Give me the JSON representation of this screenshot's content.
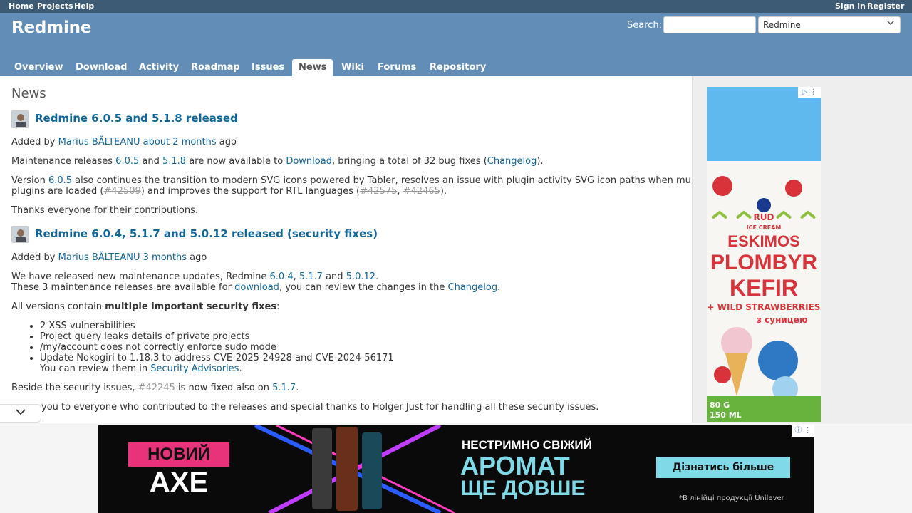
{
  "top_menu": {
    "home": "Home",
    "projects": "Projects",
    "help": "Help",
    "sign_in": "Sign in",
    "register": "Register"
  },
  "header": {
    "title": "Redmine",
    "search_label": "Search:",
    "search_value": "",
    "project_select": "Redmine"
  },
  "tabs": [
    "Overview",
    "Download",
    "Activity",
    "Roadmap",
    "Issues",
    "News",
    "Wiki",
    "Forums",
    "Repository"
  ],
  "selected_tab": "News",
  "page_title": "News",
  "news": [
    {
      "title": "Redmine 6.0.5 and 5.1.8 released",
      "added_by": "Added by",
      "author": "Marius BĂLTEANU",
      "ago_link": "about 2 months",
      "ago_suffix": "ago",
      "p1": {
        "t1": "Maintenance releases ",
        "l1": "6.0.5",
        "t2": " and ",
        "l2": "5.1.8",
        "t3": " are now available to ",
        "l3": "Download",
        "t4": ", bringing a total of 32 bug fixes (",
        "l4": "Changelog",
        "t5": ")."
      },
      "p2": {
        "t1": "Version ",
        "l1": "6.0.5",
        "t2": " also continues the transition to modern SVG icons powered by Tabler, resolves an issue with plugin activity SVG icon paths when multiple",
        "t3": "plugins are loaded (",
        "s1": "#42509",
        "t4": ") and improves the support for RTL languages (",
        "s2": "#42575",
        "t5": ", ",
        "s3": "#42465",
        "t6": ")."
      },
      "p3": "Thanks everyone for their contributions."
    },
    {
      "title": "Redmine 6.0.4, 5.1.7 and 5.0.12 released (security fixes)",
      "added_by": "Added by",
      "author": "Marius BĂLTEANU",
      "ago_link": "3 months",
      "ago_suffix": "ago",
      "p1": {
        "t1": "We have released new maintenance updates, Redmine ",
        "l1": "6.0.4",
        "t2": ", ",
        "l2": "5.1.7",
        "t3": " and ",
        "l3": "5.0.12",
        "t4": ".",
        "t5": "These 3 maintenance releases are available for ",
        "l4": "download",
        "t6": ", you can review the changes in the ",
        "l5": "Changelog",
        "t7": "."
      },
      "p2": {
        "t1": "All versions contain ",
        "b1": "multiple important security fixes",
        "t2": ":"
      },
      "list": [
        "2 XSS vulnerabilities",
        "Project query leaks details of private projects",
        "/my/account does not correctly enforce sudo mode",
        "Update Nokogiri to 1.18.3 to address CVE-2025-24928 and CVE-2024-56171"
      ],
      "list_extra": {
        "t1": "You can review them in ",
        "l1": "Security Advisories",
        "t2": "."
      },
      "p3": {
        "t1": "Beside the security issues, ",
        "s1": "#42245",
        "t2": " is now fixed also on ",
        "l1": "5.1.7",
        "t3": "."
      },
      "p4": "you to everyone who contributed to the releases and special thanks to Holger Just for handling all these security issues."
    }
  ],
  "side_ad": {
    "brand": "RUD",
    "sub": "ICE CREAM",
    "line1": "ESKIMOS",
    "line2": "PLOMBYR",
    "line3": "KEFIR",
    "line4": "+ WILD STRAWBERRIES",
    "line5": "з суницею",
    "weight": "80 G",
    "volume": "150 ML"
  },
  "bottom_ad": {
    "new_label": "НОВИЙ",
    "brand": "AXE",
    "headline1": "НЕСТРИМНО СВІЖИЙ",
    "headline2": "АРОМАТ",
    "headline3": "ЩЕ ДОВШЕ",
    "cta": "Дізнатись більше",
    "footnote": "*В лінійці продукції Unilever"
  },
  "colors": {
    "header_bg": "#628db6",
    "top_menu_bg": "#3e5b76",
    "link": "#169"
  }
}
